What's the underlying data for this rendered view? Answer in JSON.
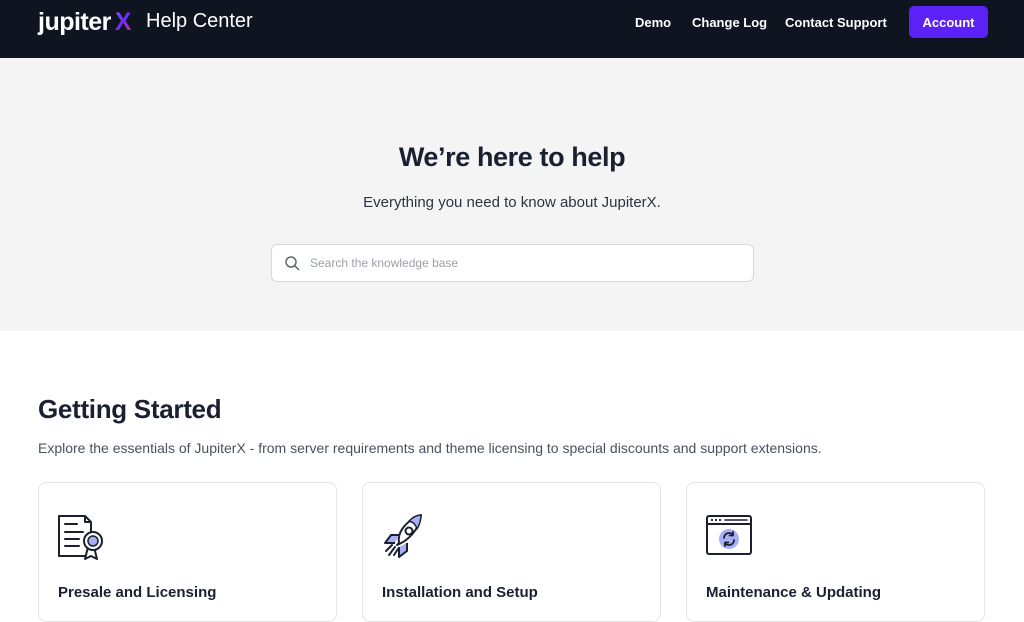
{
  "header": {
    "logo_word": "jupiter",
    "logo_mark": "X",
    "site_title": "Help Center",
    "nav": {
      "demo": "Demo",
      "changelog": "Change Log",
      "contact": "Contact Support"
    },
    "account_label": "Account"
  },
  "hero": {
    "title": "We’re here to help",
    "subtitle": "Everything you need to know about JupiterX.",
    "search": {
      "placeholder": "Search the knowledge base",
      "value": ""
    }
  },
  "section": {
    "title": "Getting Started",
    "subtitle": "Explore the essentials of JupiterX - from server requirements and theme licensing to special discounts and support extensions.",
    "cards": [
      {
        "title": "Presale and Licensing",
        "icon": "certificate-icon"
      },
      {
        "title": "Installation and Setup",
        "icon": "rocket-icon"
      },
      {
        "title": "Maintenance & Updating",
        "icon": "browser-update-icon"
      }
    ]
  },
  "colors": {
    "topbar": "#0f1421",
    "accent": "#5b21f6",
    "hero_bg": "#f4f4f5",
    "icon_highlight": "#a8b0f5"
  }
}
